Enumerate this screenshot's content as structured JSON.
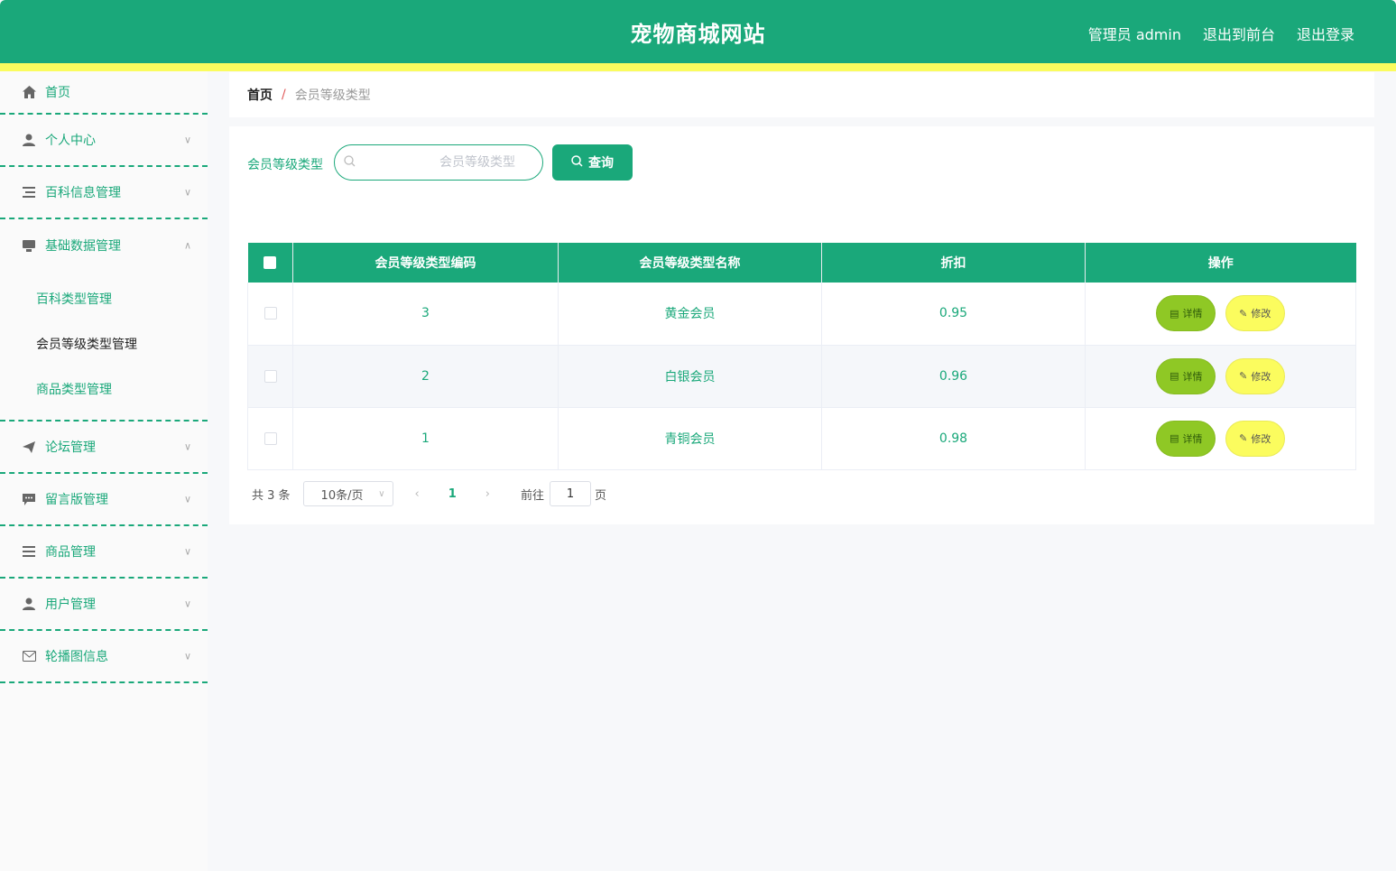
{
  "header": {
    "title": "宠物商城网站",
    "admin_label": "管理员 admin",
    "to_front_label": "退出到前台",
    "logout_label": "退出登录"
  },
  "sidebar": {
    "home": "首页",
    "items": [
      {
        "label": "个人中心",
        "icon": "user-icon"
      },
      {
        "label": "百科信息管理",
        "icon": "list-icon"
      },
      {
        "label": "基础数据管理",
        "icon": "monitor-icon",
        "expanded": true
      },
      {
        "label": "论坛管理",
        "icon": "send-icon"
      },
      {
        "label": "留言版管理",
        "icon": "message-icon"
      },
      {
        "label": "商品管理",
        "icon": "menu-icon"
      },
      {
        "label": "用户管理",
        "icon": "user-icon"
      },
      {
        "label": "轮播图信息",
        "icon": "mail-icon"
      }
    ],
    "submenu": [
      {
        "label": "百科类型管理"
      },
      {
        "label": "会员等级类型管理",
        "active": true
      },
      {
        "label": "商品类型管理"
      }
    ]
  },
  "breadcrumb": {
    "home": "首页",
    "separator": "/",
    "current": "会员等级类型"
  },
  "search": {
    "label": "会员等级类型",
    "placeholder": "会员等级类型",
    "value": "",
    "button_label": "查询"
  },
  "table": {
    "headers": [
      "会员等级类型编码",
      "会员等级类型名称",
      "折扣",
      "操作"
    ],
    "rows": [
      {
        "code": "3",
        "name": "黄金会员",
        "discount": "0.95"
      },
      {
        "code": "2",
        "name": "白银会员",
        "discount": "0.96"
      },
      {
        "code": "1",
        "name": "青铜会员",
        "discount": "0.98"
      }
    ],
    "detail_label": "详情",
    "edit_label": "修改"
  },
  "pagination": {
    "total": "共 3 条",
    "page_size": "10条/页",
    "current_page": "1",
    "goto_label": "前往",
    "goto_value": "1",
    "page_unit": "页"
  },
  "colors": {
    "primary": "#1aa87a",
    "accent_yellow": "#fbfc5e",
    "detail_green": "#8fc825"
  }
}
